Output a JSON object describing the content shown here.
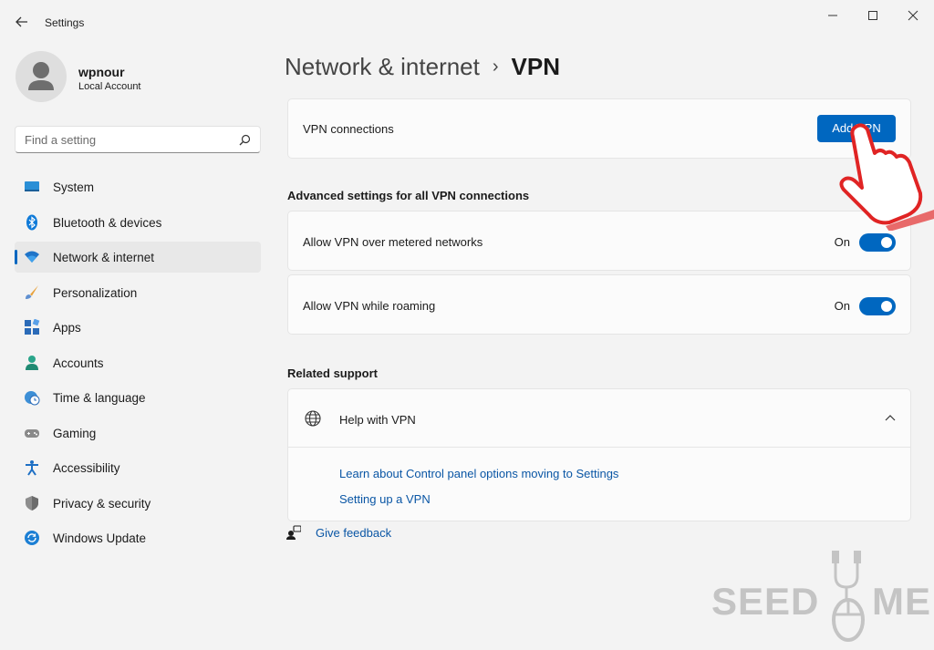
{
  "window": {
    "title": "Settings"
  },
  "profile": {
    "name": "wpnour",
    "account_type": "Local Account"
  },
  "search": {
    "placeholder": "Find a setting"
  },
  "sidebar": {
    "items": [
      {
        "label": "System",
        "icon": "system-icon"
      },
      {
        "label": "Bluetooth & devices",
        "icon": "bluetooth-icon"
      },
      {
        "label": "Network & internet",
        "icon": "wifi-icon",
        "active": true
      },
      {
        "label": "Personalization",
        "icon": "paintbrush-icon"
      },
      {
        "label": "Apps",
        "icon": "apps-icon"
      },
      {
        "label": "Accounts",
        "icon": "person-icon"
      },
      {
        "label": "Time & language",
        "icon": "clock-globe-icon"
      },
      {
        "label": "Gaming",
        "icon": "gamepad-icon"
      },
      {
        "label": "Accessibility",
        "icon": "accessibility-icon"
      },
      {
        "label": "Privacy & security",
        "icon": "shield-icon"
      },
      {
        "label": "Windows Update",
        "icon": "update-icon"
      }
    ]
  },
  "breadcrumb": {
    "parent": "Network & internet",
    "separator": "›",
    "current": "VPN"
  },
  "vpn_connections": {
    "label": "VPN connections",
    "button": "Add VPN"
  },
  "advanced": {
    "title": "Advanced settings for all VPN connections",
    "settings": [
      {
        "label": "Allow VPN over metered networks",
        "state": "On",
        "enabled": true
      },
      {
        "label": "Allow VPN while roaming",
        "state": "On",
        "enabled": true
      }
    ]
  },
  "related": {
    "title": "Related support",
    "help_title": "Help with VPN",
    "links": [
      "Learn about Control panel options moving to Settings",
      "Setting up a VPN"
    ]
  },
  "feedback": {
    "label": "Give feedback"
  },
  "watermark": {
    "left": "SEED",
    "right": "ME"
  },
  "colors": {
    "accent": "#0067c0",
    "background": "#f3f3f3",
    "card": "#fbfbfb",
    "link": "#0a56a5",
    "pointer": "#e02424"
  }
}
